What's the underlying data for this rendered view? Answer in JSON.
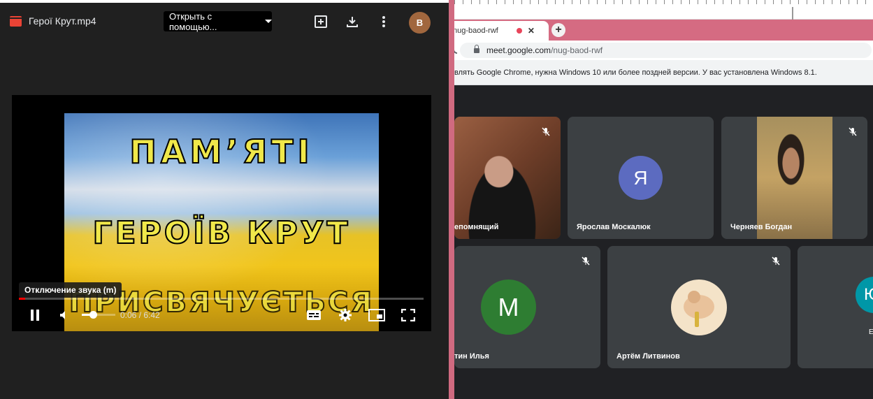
{
  "viewer": {
    "file_name": "Герої Крут.mp4",
    "open_with_label": "Открыть с помощью...",
    "avatar_letter": "В",
    "icons": [
      "video-file-icon",
      "add-to-drive-icon",
      "download-icon",
      "more-vert-icon"
    ],
    "video_overlay": {
      "line1": "ПАМ’ЯТІ",
      "line2": "ГЕРОЇВ КРУТ",
      "line3": "ПРИСВЯЧУЄТЬСЯ"
    },
    "player": {
      "tooltip": "Отключение звука (m)",
      "time": "0:06 / 6:42",
      "progress_fraction": 0.016,
      "volume_fraction": 0.35,
      "controls": [
        "pause-icon",
        "volume-icon",
        "subtitles-icon",
        "settings-icon",
        "miniplayer-icon",
        "fullscreen-icon"
      ]
    }
  },
  "browser": {
    "tab_title": "nug-baod-rwf",
    "tab_recording": true,
    "new_tab_label": "+",
    "url_host": "meet.google.com",
    "url_path": "/nug-baod-rwf",
    "info_message": "влять Google Chrome, нужна Windows 10 или более поздней версии. У вас установлена Windows 8.1."
  },
  "meet": {
    "colors": {
      "background": "#202124",
      "tile": "#3c4043",
      "ya": "#5c6bc0",
      "m": "#2e7d32",
      "yu": "#0097a7"
    },
    "participants": [
      {
        "name": "Непомнящий",
        "visible_name": "епомнящий",
        "type": "camera",
        "muted": true
      },
      {
        "name": "Ярослав Москалюк",
        "type": "avatar",
        "letter": "Я",
        "muted": false
      },
      {
        "name": "Черняев Богдан",
        "type": "camera",
        "muted": true
      },
      {
        "name": "тин Илья",
        "type": "avatar",
        "letter": "М",
        "muted": true
      },
      {
        "name": "Артём Литвинов",
        "type": "image",
        "muted": true
      },
      {
        "name": "Е",
        "type": "avatar",
        "letter": "Ю",
        "muted": false
      }
    ]
  }
}
